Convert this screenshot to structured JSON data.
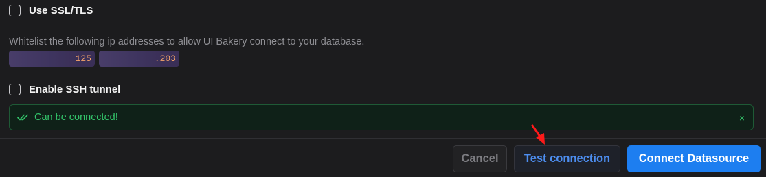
{
  "ssl": {
    "label": "Use SSL/TLS",
    "checked": false
  },
  "whitelist": {
    "note": "Whitelist the following ip addresses to allow UI Bakery connect to your database.",
    "ips": [
      "125",
      ".203"
    ]
  },
  "ssh": {
    "label": "Enable SSH tunnel",
    "checked": false
  },
  "status": {
    "message": "Can be connected!",
    "icon": "double-check-icon",
    "close_symbol": "×",
    "color": "#33c46a"
  },
  "footer": {
    "cancel_label": "Cancel",
    "test_label": "Test connection",
    "connect_label": "Connect Datasource"
  },
  "colors": {
    "accent": "#1d7ef0",
    "success": "#33c46a",
    "arrow": "#ff1a1a"
  }
}
